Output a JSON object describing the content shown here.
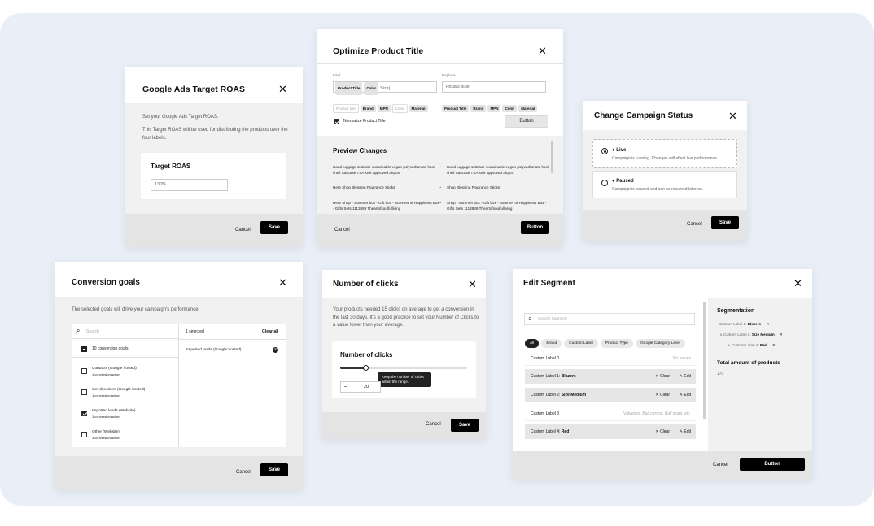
{
  "roas": {
    "title": "Google Ads Target ROAS",
    "intro": "Set your Google Ads Target ROAS.",
    "desc": "This Target ROAS will be used for distributing the products over the four labels.",
    "card_label": "Target ROAS",
    "input_value": "130%",
    "cancel": "Cancel",
    "save": "Save"
  },
  "optimize": {
    "title": "Optimize Product Title",
    "find_label": "Find",
    "replace_label": "Replace",
    "find_chips": [
      "Product Title",
      "Color"
    ],
    "find_value": "Size|",
    "replace_value": "Rituals blue",
    "find_tokens": [
      "Product title",
      "Brand",
      "MPN",
      "Color",
      "Material"
    ],
    "replace_tokens": [
      "Product Title",
      "Brand",
      "MPN",
      "Color",
      "Material"
    ],
    "normalize": "Normalize Product Title",
    "button": "Button",
    "preview_title": "Preview Changes",
    "arrow": "→",
    "rows": [
      {
        "from": "Hand luggage suitcase sustainable vegan polycarbonate hard shell Suitcase TSA lock approved airport",
        "to": "Hand luggage suitcase sustainable vegan polycarbonate hard shell Suitcase TSA lock approved airport"
      },
      {
        "from": "Here Shop Blessing Fragrance Sticks",
        "to": "Shop Blessing Fragrance Sticks"
      },
      {
        "from": "Here Shop - Summer box - Gift box - Summer of Happiness Box - Gifts Sets 1113889 Theartofsoulfulliving",
        "to": "Shop - Summer box - Gift box - Summer of Happiness Box - Gifts Sets 1113889 Theartofsoulfulliving"
      }
    ],
    "cancel": "Cancel",
    "footer_button": "Button"
  },
  "status": {
    "title": "Change Campaign Status",
    "live_label": "Live",
    "live_desc": "Campaign is running. Changes will affect live performance.",
    "paused_label": "Paused",
    "paused_desc": "Campaign is paused and can be resumed later on.",
    "cancel": "Cancel",
    "save": "Save"
  },
  "goals": {
    "title": "Conversion goals",
    "intro": "The selected goals will drive your campaign's performance.",
    "search_placeholder": "Search",
    "selected_count": "1 selected",
    "clear_all": "Clear all",
    "group_label": "10 conversion goals",
    "items": [
      {
        "name": "Contacts (Google hosted)",
        "sub": "1 conversion action",
        "checked": false
      },
      {
        "name": "Get directions (Google hosted)",
        "sub": "1 conversion action",
        "checked": false
      },
      {
        "name": "Imported leads (Website)",
        "sub": "1 conversion action",
        "checked": true
      },
      {
        "name": "Other (Website)",
        "sub": "3 conversion action",
        "checked": false
      }
    ],
    "selected_item": "Imported leads (Google hosted)",
    "cancel": "Cancel",
    "save": "Save"
  },
  "clicks": {
    "title": "Number of clicks",
    "desc": "Your products needed 15 clicks on average to get a conversion in the last 30 days. It's a good practice to set your Number of Clicks to a value lower than your average.",
    "card_label": "Number of clicks",
    "tooltip": "Keep the number of clicks within the range.",
    "value": "20",
    "slider_fraction": 0.2,
    "minus": "–",
    "cancel": "Cancel",
    "save": "Save"
  },
  "segment": {
    "title": "Edit Segment",
    "search_placeholder": "Search Segment",
    "filters": [
      "All",
      "Brand",
      "Custom Label",
      "Product Type",
      "Google Category Level"
    ],
    "rows": [
      {
        "label": "Custom Label 0",
        "value": "",
        "right": "No values",
        "selected": false
      },
      {
        "label": "Custom Label 1: ",
        "value": "Blazers",
        "right": "",
        "selected": true
      },
      {
        "label": "Custom Label 2: ",
        "value": "Size Medium",
        "right": "",
        "selected": true
      },
      {
        "label": "Custom Label 3",
        "value": "",
        "right": "Valuelem, Ball normal, Ball grant, etc.",
        "selected": false
      },
      {
        "label": "Custom Label 4: ",
        "value": "Red",
        "right": "",
        "selected": true
      }
    ],
    "clear": "Clear",
    "edit": "Edit",
    "seg_title": "Segmentation",
    "tree": [
      {
        "label": "Custom Label 1: ",
        "value": "Blazers"
      },
      {
        "label": "Custom Label 2: ",
        "value": "Size Medium"
      },
      {
        "label": "Custom Label 4: ",
        "value": "Red"
      }
    ],
    "total_label": "Total amount of products",
    "total_value": "170",
    "cancel": "Cancel",
    "button": "Button"
  }
}
